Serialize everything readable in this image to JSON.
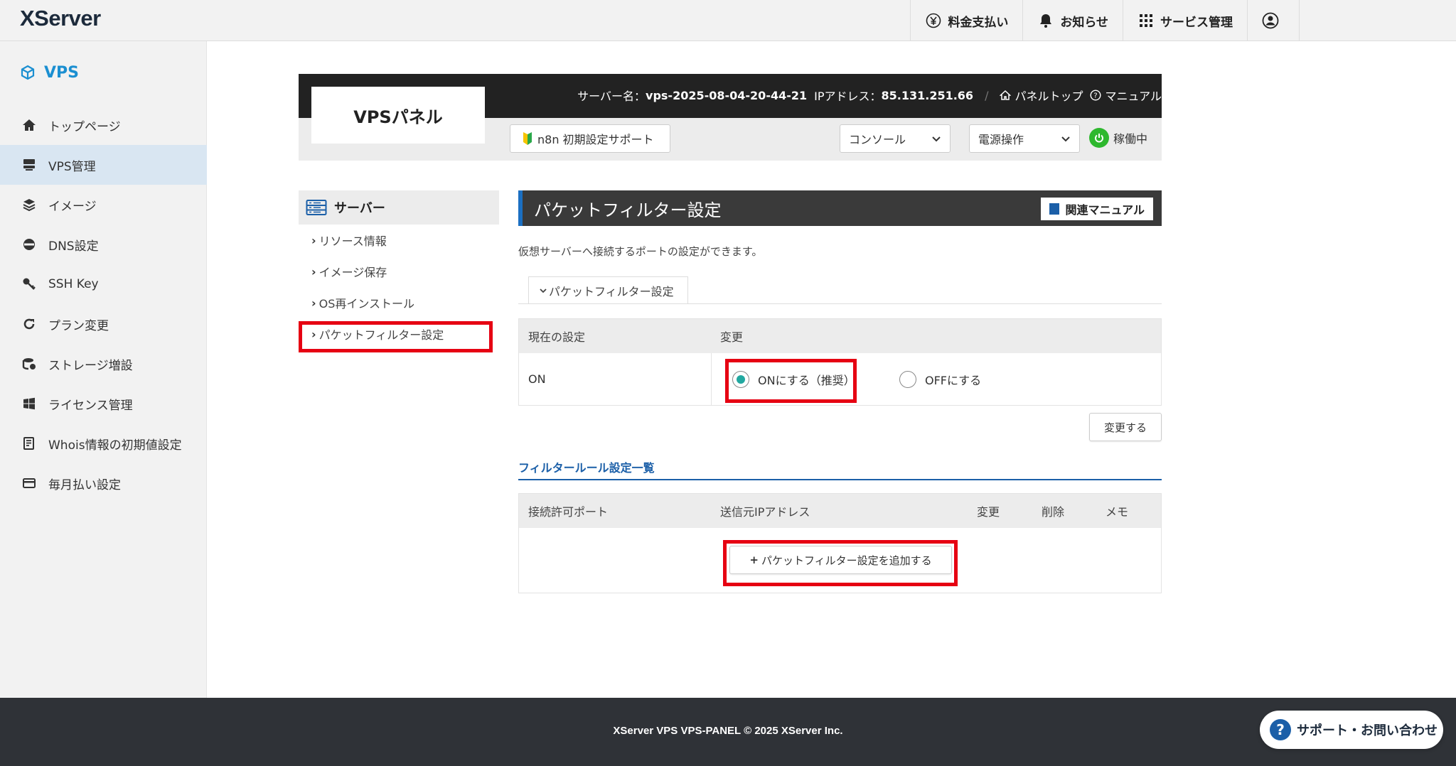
{
  "header": {
    "logo": "XServer",
    "nav": [
      {
        "label": "料金支払い",
        "icon": "yen-icon"
      },
      {
        "label": "お知らせ",
        "icon": "bell-icon"
      },
      {
        "label": "サービス管理",
        "icon": "grid-icon"
      }
    ],
    "account_icon": "user-circle-icon"
  },
  "sidebar": {
    "brand": "VPS",
    "items": [
      {
        "label": "トップページ",
        "icon": "home-icon"
      },
      {
        "label": "VPS管理",
        "icon": "server-icon"
      },
      {
        "label": "イメージ",
        "icon": "layers-icon"
      },
      {
        "label": "DNS設定",
        "icon": "dns-icon"
      },
      {
        "label": "SSH Key",
        "icon": "key-icon"
      },
      {
        "label": "プラン変更",
        "icon": "refresh-icon"
      },
      {
        "label": "ストレージ増設",
        "icon": "storage-icon"
      },
      {
        "label": "ライセンス管理",
        "icon": "windows-icon"
      },
      {
        "label": "Whois情報の初期値設定",
        "icon": "document-icon"
      },
      {
        "label": "毎月払い設定",
        "icon": "card-icon"
      }
    ]
  },
  "panel": {
    "title": "VPSパネル",
    "server_label": "サーバー名：",
    "server_name": "vps-2025-08-04-20-44-21",
    "ip_label": "IPアドレス：",
    "ip": "85.131.251.66",
    "separator": "/",
    "panel_top": "パネルトップ",
    "manual": "マニュアル",
    "n8n_button": "n8n 初期設定サポート",
    "console_select": "コンソール",
    "power_select": "電源操作",
    "status": "稼働中"
  },
  "submenu": {
    "title": "サーバー",
    "items": [
      "リソース情報",
      "イメージ保存",
      "OS再インストール",
      "パケットフィルター設定"
    ]
  },
  "main": {
    "title": "パケットフィルター設定",
    "manual_button": "関連マニュアル",
    "description": "仮想サーバーへ接続するポートの設定ができます。",
    "tab": "パケットフィルター設定",
    "settings_table": {
      "col_current": "現在の設定",
      "col_change": "変更",
      "current_value": "ON",
      "option_on": "ONにする（推奨）",
      "option_off": "OFFにする",
      "selected": "on"
    },
    "change_button": "変更する",
    "rules_title": "フィルタールール設定一覧",
    "rules_table": {
      "headers": [
        "接続許可ポート",
        "送信元IPアドレス",
        "変更",
        "削除",
        "メモ"
      ]
    },
    "add_rule_button": "パケットフィルター設定を追加する"
  },
  "footer": {
    "copyright": "XServer VPS VPS-PANEL © 2025 XServer Inc.",
    "support_button": "サポート・お問い合わせ"
  },
  "colors": {
    "accent_blue": "#1b5fa8",
    "highlight_red": "#e60012",
    "status_green": "#2eb82e",
    "radio_teal": "#22a8a0"
  }
}
